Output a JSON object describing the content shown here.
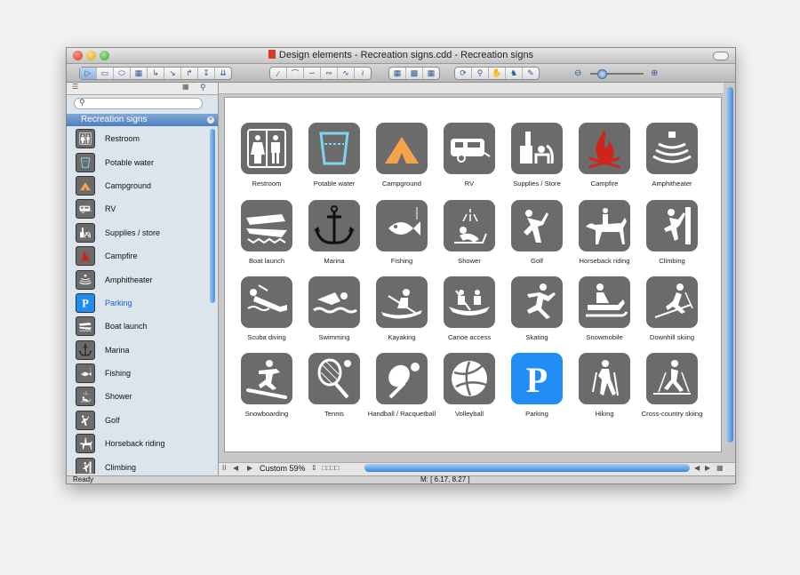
{
  "window": {
    "title": "Design elements - Recreation signs.cdd - Recreation signs"
  },
  "sidebar": {
    "search_placeholder": "",
    "library_title": "Recreation signs",
    "items": [
      {
        "label": "Restroom",
        "icon": "restroom-icon"
      },
      {
        "label": "Potable water",
        "icon": "potable-water-icon"
      },
      {
        "label": "Campground",
        "icon": "campground-icon"
      },
      {
        "label": "RV",
        "icon": "rv-icon"
      },
      {
        "label": "Supplies / store",
        "icon": "supplies-icon"
      },
      {
        "label": "Campfire",
        "icon": "campfire-icon"
      },
      {
        "label": "Amphitheater",
        "icon": "amphitheater-icon"
      },
      {
        "label": "Parking",
        "icon": "parking-icon",
        "selected": true
      },
      {
        "label": "Boat launch",
        "icon": "boat-launch-icon"
      },
      {
        "label": "Marina",
        "icon": "marina-icon"
      },
      {
        "label": "Fishing",
        "icon": "fishing-icon"
      },
      {
        "label": "Shower",
        "icon": "shower-icon"
      },
      {
        "label": "Golf",
        "icon": "golf-icon"
      },
      {
        "label": "Horseback riding",
        "icon": "horseback-icon"
      },
      {
        "label": "Climbing",
        "icon": "climbing-icon"
      }
    ]
  },
  "canvas": {
    "icons": [
      {
        "label": "Restroom",
        "icon": "restroom-icon"
      },
      {
        "label": "Potable water",
        "icon": "potable-water-icon"
      },
      {
        "label": "Campground",
        "icon": "campground-icon"
      },
      {
        "label": "RV",
        "icon": "rv-icon"
      },
      {
        "label": "Supplies / Store",
        "icon": "supplies-icon"
      },
      {
        "label": "Campfire",
        "icon": "campfire-icon"
      },
      {
        "label": "Amphitheater",
        "icon": "amphitheater-icon"
      },
      {
        "label": "Boat launch",
        "icon": "boat-launch-icon"
      },
      {
        "label": "Marina",
        "icon": "marina-icon"
      },
      {
        "label": "Fishing",
        "icon": "fishing-icon"
      },
      {
        "label": "Shower",
        "icon": "shower-icon"
      },
      {
        "label": "Golf",
        "icon": "golf-icon"
      },
      {
        "label": "Horseback riding",
        "icon": "horseback-icon"
      },
      {
        "label": "Climbing",
        "icon": "climbing-icon"
      },
      {
        "label": "Scuba diving",
        "icon": "scuba-icon"
      },
      {
        "label": "Swimming",
        "icon": "swimming-icon"
      },
      {
        "label": "Kayaking",
        "icon": "kayaking-icon"
      },
      {
        "label": "Canoe access",
        "icon": "canoe-icon"
      },
      {
        "label": "Skating",
        "icon": "skating-icon"
      },
      {
        "label": "Snowmobile",
        "icon": "snowmobile-icon"
      },
      {
        "label": "Downhill skiing",
        "icon": "downhill-skiing-icon"
      },
      {
        "label": "Snowboarding",
        "icon": "snowboarding-icon"
      },
      {
        "label": "Tennis",
        "icon": "tennis-icon"
      },
      {
        "label": "Handball / Racquetball",
        "icon": "handball-icon"
      },
      {
        "label": "Volleyball",
        "icon": "volleyball-icon"
      },
      {
        "label": "Parking",
        "icon": "parking-icon"
      },
      {
        "label": "Hiking",
        "icon": "hiking-icon"
      },
      {
        "label": "Cross-country skiing",
        "icon": "cross-country-skiing-icon"
      }
    ]
  },
  "bottom": {
    "zoom": "Custom 59%"
  },
  "status": {
    "left": "Ready",
    "mouse": "M: [ 6.17, 8.27 ]"
  },
  "colors": {
    "accent": "#1f8df3",
    "icon_tile": "#6b6b6b",
    "campground": "#f4a34a",
    "campfire": "#d0241b",
    "water": "#7fd4f0"
  }
}
